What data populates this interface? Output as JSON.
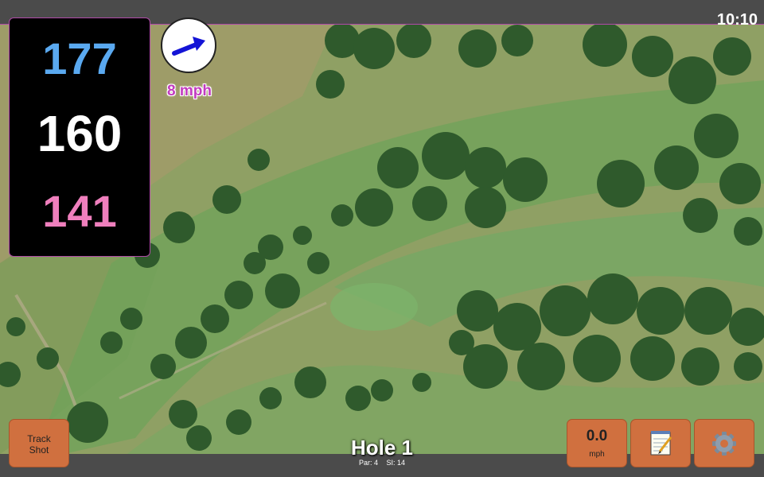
{
  "status_bar": {
    "time": "10:10"
  },
  "yardage": {
    "back": "177",
    "center": "160",
    "front": "141",
    "colors": {
      "back": "#5aa9f0",
      "center": "#ffffff",
      "front": "#ef7fbd"
    }
  },
  "wind": {
    "speed_label": "8 mph",
    "direction_icon": "wind-arrow-icon"
  },
  "hole": {
    "title": "Hole 1",
    "par_label": "Par: 4",
    "si_label": "SI: 14"
  },
  "buttons": {
    "track_shot_line1": "Track",
    "track_shot_line2": "Shot",
    "speed_value": "0.0",
    "speed_unit": "mph",
    "notes_icon": "notepad-icon",
    "settings_icon": "gear-icon"
  },
  "colors": {
    "button_accent": "#d0703f",
    "border_accent": "#b04aa8"
  }
}
